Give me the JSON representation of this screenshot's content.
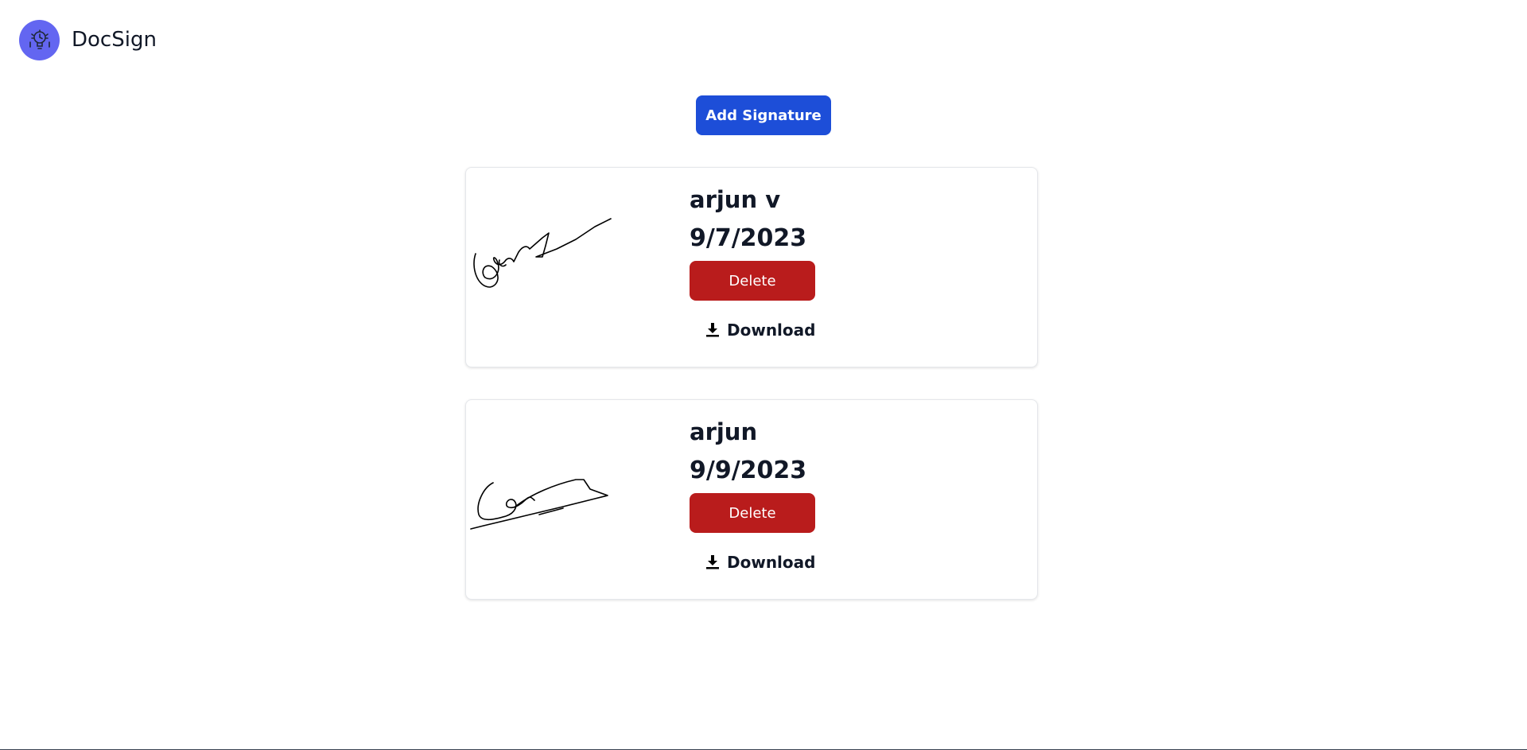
{
  "header": {
    "logo_icon": "clock-lightbulb-icon",
    "brand": "DocSign",
    "logo_color": "#6366f1"
  },
  "toolbar": {
    "add_signature_label": "Add Signature",
    "add_color": "#1d4ed8"
  },
  "signatures": [
    {
      "name": "arjun v",
      "date": "9/7/2023",
      "delete_label": "Delete",
      "download_label": "Download"
    },
    {
      "name": "arjun",
      "date": "9/9/2023",
      "delete_label": "Delete",
      "download_label": "Download"
    }
  ],
  "colors": {
    "delete": "#b91c1c",
    "text": "#111827"
  }
}
